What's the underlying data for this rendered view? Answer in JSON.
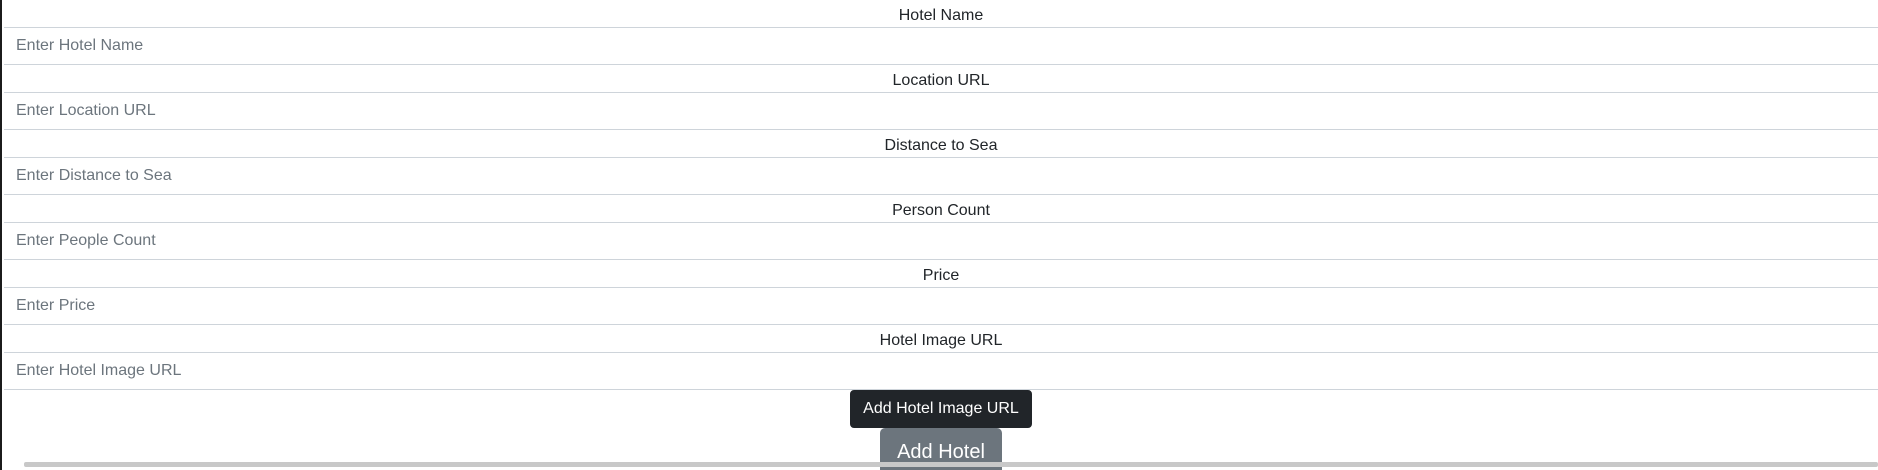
{
  "form": {
    "fields": [
      {
        "label": "Hotel Name",
        "placeholder": "Enter Hotel Name"
      },
      {
        "label": "Location URL",
        "placeholder": "Enter Location URL"
      },
      {
        "label": "Distance to Sea",
        "placeholder": "Enter Distance to Sea"
      },
      {
        "label": "Person Count",
        "placeholder": "Enter People Count"
      },
      {
        "label": "Price",
        "placeholder": "Enter Price"
      },
      {
        "label": "Hotel Image URL",
        "placeholder": "Enter Hotel Image URL"
      }
    ],
    "add_image_button": "Add Hotel Image URL",
    "submit_button": "Add Hotel"
  },
  "colors": {
    "dark_button": "#212529",
    "secondary_button": "#6c757d",
    "placeholder": "#6c757d",
    "border": "#ced4da"
  }
}
